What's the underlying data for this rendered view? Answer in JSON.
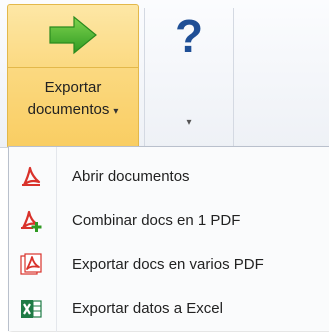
{
  "ribbon": {
    "export_button": {
      "line1": "Exportar",
      "line2": "documentos",
      "caret": "▾",
      "icon": "green-right-arrow-icon"
    },
    "help_button": {
      "glyph": "?",
      "caret": "▾",
      "icon": "question-mark-icon"
    }
  },
  "menu": {
    "items": [
      {
        "label": "Abrir documentos",
        "icon": "pdf-icon"
      },
      {
        "label": "Combinar docs en 1 PDF",
        "icon": "pdf-merge-icon"
      },
      {
        "label": "Exportar docs en varios PDF",
        "icon": "pdf-multiple-icon"
      },
      {
        "label": "Exportar datos a Excel",
        "icon": "excel-icon"
      }
    ]
  },
  "colors": {
    "accent": "#f9cd62",
    "accent_border": "#e3b84a",
    "pdf_red": "#d9322b",
    "arrow_green": "#3faa2f",
    "help_blue": "#1f4f96",
    "excel_green": "#1e7b45"
  }
}
